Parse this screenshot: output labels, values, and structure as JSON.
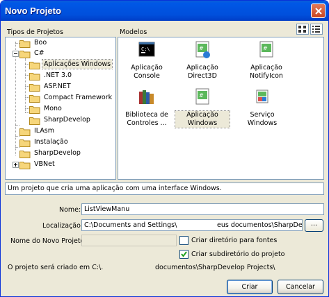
{
  "window": {
    "title": "Novo Projeto"
  },
  "categories_panel": {
    "label": "Tipos de Projetos",
    "items": [
      {
        "label": "Boo"
      },
      {
        "label": "C#"
      },
      {
        "label": "Aplicações Windows"
      },
      {
        "label": ".NET 3.0"
      },
      {
        "label": "ASP.NET"
      },
      {
        "label": "Compact Framework"
      },
      {
        "label": "Mono"
      },
      {
        "label": "SharpDevelop"
      },
      {
        "label": "ILAsm"
      },
      {
        "label": "Instalação"
      },
      {
        "label": "SharpDevelop"
      },
      {
        "label": "VBNet"
      }
    ],
    "selected": "Aplicações Windows"
  },
  "templates_panel": {
    "label": "Modelos",
    "items": [
      {
        "label": "Aplicação Console",
        "icon": "console-app-icon"
      },
      {
        "label": "Aplicação Direct3D",
        "icon": "direct3d-app-icon"
      },
      {
        "label": "Aplicação NotifyIcon",
        "icon": "notifyicon-app-icon"
      },
      {
        "label": "Biblioteca de Controles ...",
        "icon": "control-library-icon"
      },
      {
        "label": "Aplicação Windows",
        "icon": "windows-app-icon"
      },
      {
        "label": "Serviço Windows",
        "icon": "windows-service-icon"
      }
    ],
    "selected": "Aplicação Windows"
  },
  "description": "Um projeto que cria uma aplicação com uma interface Windows.",
  "form": {
    "name_label": "Nome:",
    "name_value": "ListViewManu",
    "location_label": "Localização:",
    "location_value": "C:\\Documents and Settings\\",
    "location_value_tail": "eus documentos\\SharpDevelop",
    "browse_label": "...",
    "solution_label": "Nome do Novo Projeto",
    "solution_value": "",
    "create_dir_sources_label": "Criar diretório para fontes",
    "create_dir_sources_checked": false,
    "create_project_subdir_label": "Criar subdiretório do projeto",
    "create_project_subdir_checked": true
  },
  "path_info": {
    "prefix": "O projeto será criado em C:\\.",
    "suffix": "documentos\\SharpDevelop Projects\\"
  },
  "buttons": {
    "ok": "Criar",
    "cancel": "Cancelar"
  }
}
